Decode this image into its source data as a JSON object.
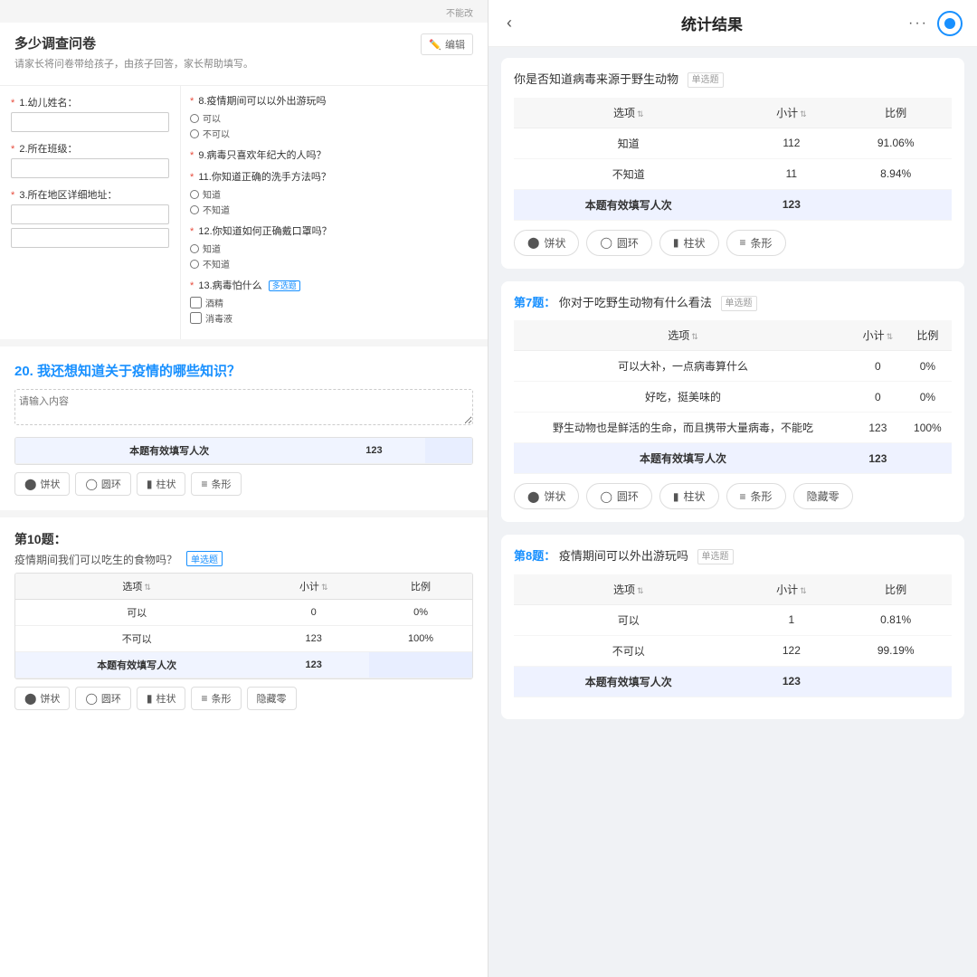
{
  "left_panel": {
    "survey": {
      "title": "多少调查问卷",
      "subtitle": "请家长将问卷带给孩子，由孩子回答，家长帮助填写。",
      "edit_btn": "编辑",
      "top_label": "不能改"
    },
    "fields": [
      {
        "number": "1",
        "label": "幼儿姓名：",
        "required": true
      },
      {
        "number": "2",
        "label": "所在班级：",
        "required": true
      },
      {
        "number": "3",
        "label": "所在地区详细地址：",
        "required": true
      }
    ],
    "right_questions": [
      {
        "number": "8",
        "title": "疫情期间可以外出游玩吗",
        "options": [
          "可以",
          "不可以"
        ],
        "required": true
      },
      {
        "number": "9",
        "title": "病毒只喜欢年纪大的人吗？",
        "required": true,
        "options": []
      },
      {
        "number": "11",
        "title": "你知道正确的洗手方法吗？",
        "required": true,
        "options": [
          "知道",
          "不知道"
        ]
      },
      {
        "number": "12",
        "title": "你知道如何正确戴口罩吗？",
        "required": true,
        "options": [
          "知道",
          "不知道"
        ]
      },
      {
        "number": "13",
        "title": "病毒怕什么",
        "badge": "多选题",
        "required": true,
        "options": [
          "酒精",
          "消毒液"
        ]
      }
    ],
    "q20": {
      "title_num": "20.",
      "title_text": "我还想知道关于疫情的哪些知识？",
      "placeholder": "请输入内容",
      "table": {
        "col1": "本题有效填写人次",
        "col2": "123"
      }
    },
    "q10": {
      "section_title": "第10题：",
      "question": "疫情期间我们可以吃生的食物吗？",
      "tag": "单选题",
      "table_headers": [
        "选项",
        "小计",
        "比例"
      ],
      "rows": [
        {
          "option": "可以",
          "count": "0",
          "percent": "0%"
        },
        {
          "option": "不可以",
          "count": "123",
          "percent": "100%"
        }
      ],
      "summary": {
        "label": "本题有效填写人次",
        "count": "123"
      },
      "chart_btns": [
        "饼状",
        "圆环",
        "柱状",
        "条形",
        "隐藏零"
      ]
    }
  },
  "right_panel": {
    "header": {
      "back_icon": "‹",
      "title": "统计结果",
      "dots_icon": "···",
      "record_icon": "●"
    },
    "q_virus_source": {
      "title": "你是否知道病毒来源于野生动物",
      "tag": "单选题",
      "table_headers": [
        "选项",
        "小计",
        "比例"
      ],
      "rows": [
        {
          "option": "知道",
          "count": "112",
          "percent": "91.06%"
        },
        {
          "option": "不知道",
          "count": "11",
          "percent": "8.94%"
        }
      ],
      "summary": {
        "label": "本题有效填写人次",
        "count": "123"
      },
      "chart_btns": [
        "饼状",
        "圆环",
        "柱状",
        "条形"
      ]
    },
    "q7": {
      "section_title": "第7题：",
      "question": "你对于吃野生动物有什么看法",
      "tag": "单选题",
      "table_headers": [
        "选项",
        "小计",
        "比例"
      ],
      "rows": [
        {
          "option": "可以大补，一点病毒算什么",
          "count": "0",
          "percent": "0%"
        },
        {
          "option": "好吃，挺美味的",
          "count": "0",
          "percent": "0%"
        },
        {
          "option": "野生动物也是鲜活的生命，而且携带大量病毒，不能吃",
          "count": "123",
          "percent": "100%"
        }
      ],
      "summary": {
        "label": "本题有效填写人次",
        "count": "123"
      },
      "chart_btns": [
        "饼状",
        "圆环",
        "柱状",
        "条形",
        "隐藏零"
      ]
    },
    "q8": {
      "section_title": "第8题：",
      "question": "疫情期间可以外出游玩吗",
      "tag": "单选题",
      "table_headers": [
        "选项",
        "小计",
        "比例"
      ],
      "rows": [
        {
          "option": "可以",
          "count": "1",
          "percent": "0.81%"
        },
        {
          "option": "不可以",
          "count": "122",
          "percent": "99.19%"
        }
      ],
      "summary": {
        "label": "本题有效填写人次",
        "count": "123"
      }
    }
  }
}
